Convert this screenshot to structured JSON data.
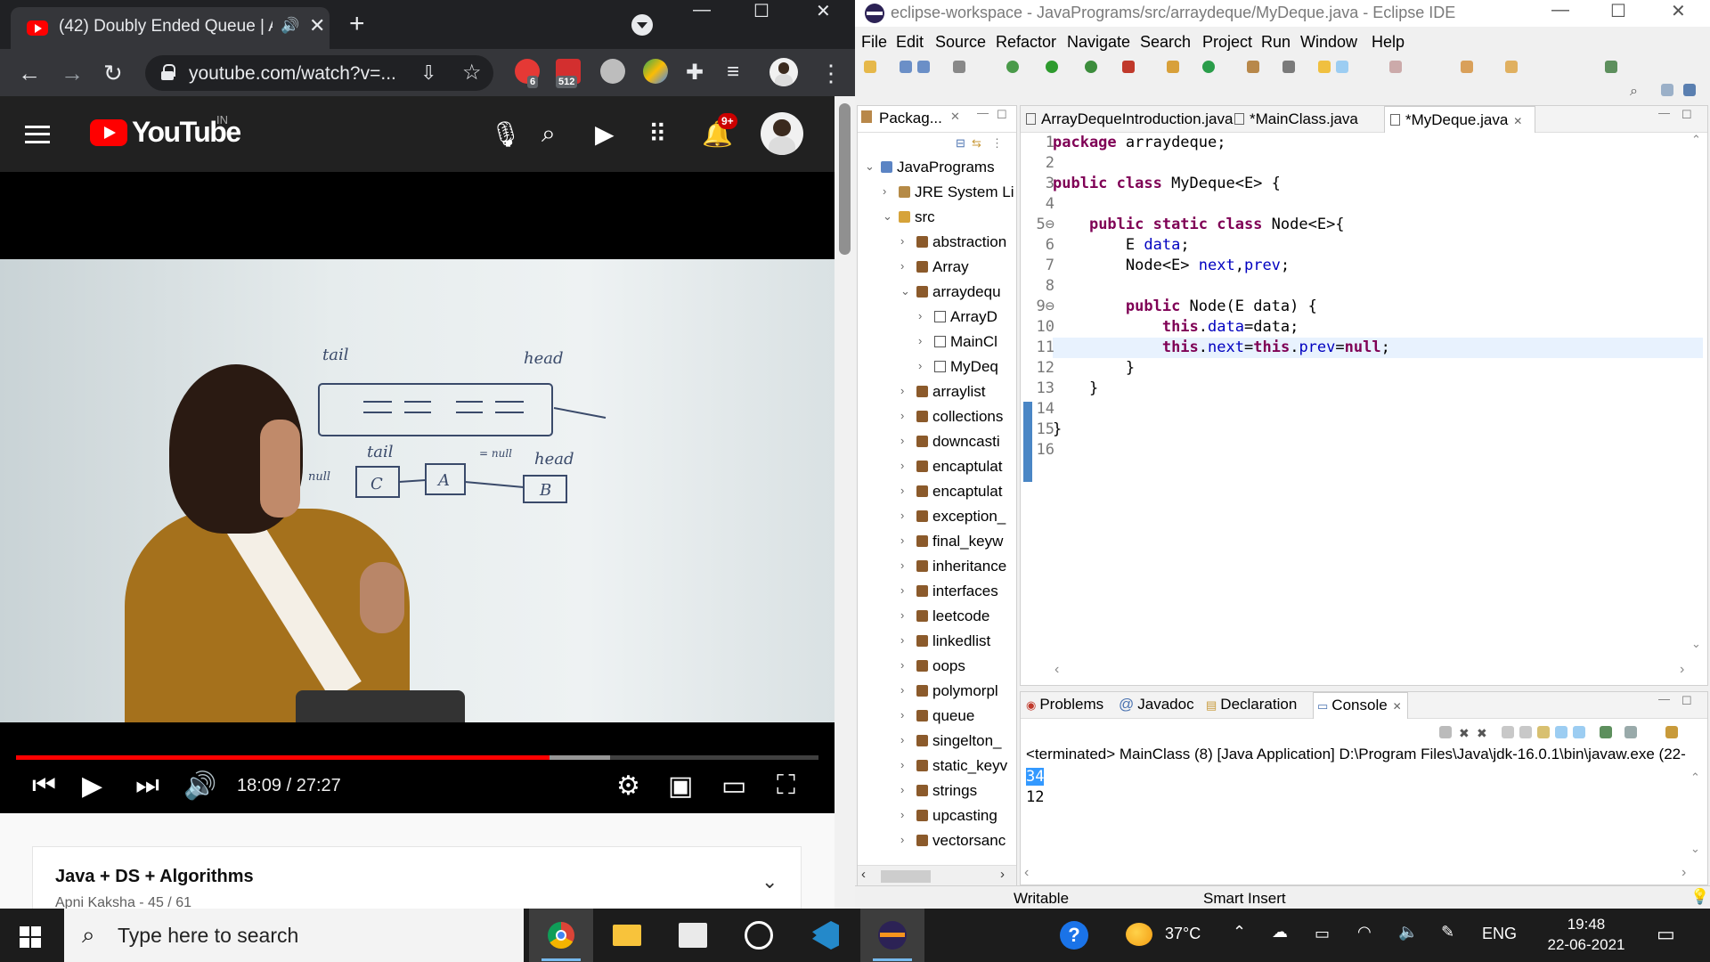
{
  "chrome": {
    "tab_title": "(42) Doubly Ended Queue | A",
    "url": "youtube.com/watch?v=...",
    "ext_abp_badge": "6",
    "ext_badge_512": "512"
  },
  "youtube": {
    "logo_text": "YouTube",
    "country": "IN",
    "notif_badge": "9+",
    "whiteboard": {
      "tail_top": "tail",
      "head_top": "head",
      "tail_mid": "tail",
      "null_mid": "= null",
      "head_mid": "head",
      "null_left": "null",
      "node_c": "C",
      "node_a": "A",
      "node_b": "B"
    },
    "time_current": "18:09",
    "time_sep": " / ",
    "time_total": "27:27",
    "progress_played_pct": 66.5,
    "progress_buffered_pct": 74,
    "playlist_title": "Java + DS + Algorithms",
    "playlist_sub": "Apni Kaksha - 45 / 61"
  },
  "eclipse": {
    "title": "eclipse-workspace - JavaPrograms/src/arraydeque/MyDeque.java - Eclipse IDE",
    "menu": [
      "File",
      "Edit",
      "Source",
      "Refactor",
      "Navigate",
      "Search",
      "Project",
      "Run",
      "Window",
      "Help"
    ],
    "pkg_tab": "Packag...",
    "tree": [
      {
        "label": "JavaPrograms",
        "indent": 0,
        "arrow": "⌄",
        "icon": "proj"
      },
      {
        "label": "JRE System Li",
        "indent": 1,
        "arrow": "›",
        "icon": "lib"
      },
      {
        "label": "src",
        "indent": 1,
        "arrow": "⌄",
        "icon": "src"
      },
      {
        "label": "abstraction",
        "indent": 2,
        "arrow": "›",
        "icon": "pkg"
      },
      {
        "label": "Array",
        "indent": 2,
        "arrow": "›",
        "icon": "pkg"
      },
      {
        "label": "arraydequ",
        "indent": 2,
        "arrow": "⌄",
        "icon": "pkg"
      },
      {
        "label": "ArrayD",
        "indent": 3,
        "arrow": "›",
        "icon": "file"
      },
      {
        "label": "MainCl",
        "indent": 3,
        "arrow": "›",
        "icon": "file"
      },
      {
        "label": "MyDeq",
        "indent": 3,
        "arrow": "›",
        "icon": "file"
      },
      {
        "label": "arraylist",
        "indent": 2,
        "arrow": "›",
        "icon": "pkg"
      },
      {
        "label": "collections",
        "indent": 2,
        "arrow": "›",
        "icon": "pkg"
      },
      {
        "label": "downcasti",
        "indent": 2,
        "arrow": "›",
        "icon": "pkg"
      },
      {
        "label": "encaptulat",
        "indent": 2,
        "arrow": "›",
        "icon": "pkg"
      },
      {
        "label": "encaptulat",
        "indent": 2,
        "arrow": "›",
        "icon": "pkg"
      },
      {
        "label": "exception_",
        "indent": 2,
        "arrow": "›",
        "icon": "pkg"
      },
      {
        "label": "final_keyw",
        "indent": 2,
        "arrow": "›",
        "icon": "pkg"
      },
      {
        "label": "inheritance",
        "indent": 2,
        "arrow": "›",
        "icon": "pkg"
      },
      {
        "label": "interfaces",
        "indent": 2,
        "arrow": "›",
        "icon": "pkg"
      },
      {
        "label": "leetcode",
        "indent": 2,
        "arrow": "›",
        "icon": "pkg"
      },
      {
        "label": "linkedlist",
        "indent": 2,
        "arrow": "›",
        "icon": "pkg"
      },
      {
        "label": "oops",
        "indent": 2,
        "arrow": "›",
        "icon": "pkg"
      },
      {
        "label": "polymorpl",
        "indent": 2,
        "arrow": "›",
        "icon": "pkg"
      },
      {
        "label": "queue",
        "indent": 2,
        "arrow": "›",
        "icon": "pkg"
      },
      {
        "label": "singelton_",
        "indent": 2,
        "arrow": "›",
        "icon": "pkg"
      },
      {
        "label": "static_keyv",
        "indent": 2,
        "arrow": "›",
        "icon": "pkg"
      },
      {
        "label": "strings",
        "indent": 2,
        "arrow": "›",
        "icon": "pkg"
      },
      {
        "label": "upcasting",
        "indent": 2,
        "arrow": "›",
        "icon": "pkg"
      },
      {
        "label": "vectorsanc",
        "indent": 2,
        "arrow": "›",
        "icon": "pkg"
      }
    ],
    "editor_tabs": [
      "ArrayDequeIntroduction.java",
      "*MainClass.java",
      "*MyDeque.java"
    ],
    "code": [
      {
        "n": "1",
        "t": [
          [
            "kw",
            "package"
          ],
          [
            "",
            " arraydeque;"
          ]
        ]
      },
      {
        "n": "2",
        "t": []
      },
      {
        "n": "3",
        "t": [
          [
            "kw",
            "public class"
          ],
          [
            "",
            " MyDeque<E> {"
          ]
        ]
      },
      {
        "n": "4",
        "t": []
      },
      {
        "n": "5⊖",
        "t": [
          [
            "",
            "    "
          ],
          [
            "kw",
            "public static class"
          ],
          [
            "",
            " Node<E>{"
          ]
        ]
      },
      {
        "n": "6",
        "t": [
          [
            "",
            "        E "
          ],
          [
            "fld",
            "data"
          ],
          [
            "",
            ";"
          ]
        ]
      },
      {
        "n": "7",
        "t": [
          [
            "",
            "        Node<E> "
          ],
          [
            "fld",
            "next"
          ],
          [
            "",
            ","
          ],
          [
            "fld",
            "prev"
          ],
          [
            "",
            ";"
          ]
        ]
      },
      {
        "n": "8",
        "t": []
      },
      {
        "n": "9⊖",
        "t": [
          [
            "",
            "        "
          ],
          [
            "kw",
            "public"
          ],
          [
            "",
            " Node(E data) {"
          ]
        ]
      },
      {
        "n": "10",
        "t": [
          [
            "",
            "            "
          ],
          [
            "kw",
            "this"
          ],
          [
            "",
            "."
          ],
          [
            "fld",
            "data"
          ],
          [
            "",
            "=data;"
          ]
        ]
      },
      {
        "n": "11",
        "t": [
          [
            "",
            "            "
          ],
          [
            "kw",
            "this"
          ],
          [
            "",
            "."
          ],
          [
            "fld",
            "next"
          ],
          [
            "",
            "="
          ],
          [
            "kw",
            "this"
          ],
          [
            "",
            "."
          ],
          [
            "fld",
            "prev"
          ],
          [
            "",
            "="
          ],
          [
            "kw",
            "null"
          ],
          [
            "",
            ";"
          ]
        ],
        "hl": true
      },
      {
        "n": "12",
        "t": [
          [
            "",
            "        }"
          ]
        ]
      },
      {
        "n": "13",
        "t": [
          [
            "",
            "    }"
          ]
        ]
      },
      {
        "n": "14",
        "t": []
      },
      {
        "n": "15",
        "t": [
          [
            "",
            "}"
          ]
        ]
      },
      {
        "n": "16",
        "t": []
      }
    ],
    "console_tabs": [
      "Problems",
      "Javadoc",
      "Declaration",
      "Console"
    ],
    "console_terminated": "<terminated> MainClass (8) [Java Application] D:\\Program Files\\Java\\jdk-16.0.1\\bin\\javaw.exe  (22-",
    "console_lines": [
      "34",
      "12"
    ],
    "status_writable": "Writable",
    "status_insert": "Smart Insert"
  },
  "taskbar": {
    "search_placeholder": "Type here to search",
    "temperature": "37°C",
    "language": "ENG",
    "time": "19:48",
    "date": "22-06-2021"
  }
}
